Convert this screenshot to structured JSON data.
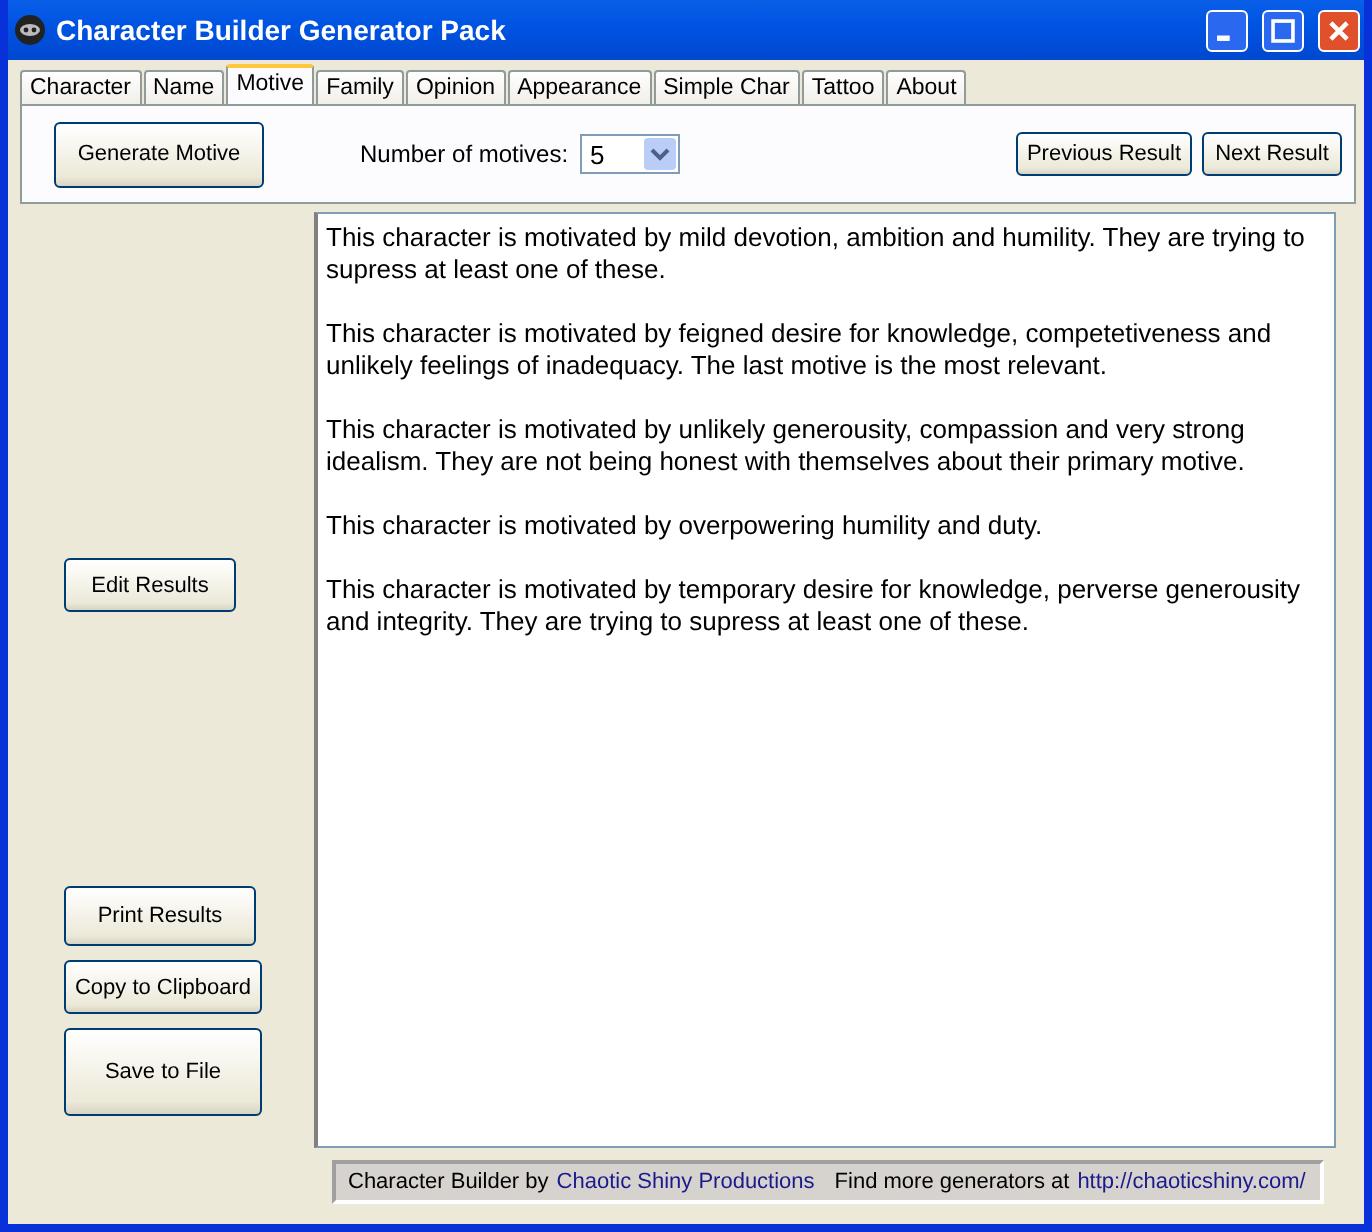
{
  "window": {
    "title": "Character Builder Generator Pack"
  },
  "tabs": [
    {
      "label": "Character",
      "selected": false
    },
    {
      "label": "Name",
      "selected": false
    },
    {
      "label": "Motive",
      "selected": true
    },
    {
      "label": "Family",
      "selected": false
    },
    {
      "label": "Opinion",
      "selected": false
    },
    {
      "label": "Appearance",
      "selected": false
    },
    {
      "label": "Simple Char",
      "selected": false
    },
    {
      "label": "Tattoo",
      "selected": false
    },
    {
      "label": "About",
      "selected": false
    }
  ],
  "toolbar": {
    "generate_button": "Generate Motive",
    "motives_label": "Number of motives:",
    "motives_value": "5",
    "previous_button": "Previous Result",
    "next_button": "Next Result"
  },
  "side_buttons": {
    "edit": "Edit Results",
    "print": "Print Results",
    "copy": "Copy to Clipboard",
    "save": "Save to File"
  },
  "results": [
    "This character is motivated by mild devotion, ambition and humility. They are trying to supress at least one of these.",
    "This character is motivated by feigned desire for knowledge, competetiveness and unlikely feelings of inadequacy. The last motive is the most relevant.",
    "This character is motivated by unlikely generousity, compassion and very strong idealism. They are not being honest with themselves about their primary motive.",
    "This character is motivated by overpowering humility and duty.",
    "This character is motivated by temporary desire for knowledge, perverse generousity and integrity. They are trying to supress at least one of these."
  ],
  "status_bar": {
    "credit_prefix": "Character Builder by",
    "credit_link": "Chaotic Shiny Productions",
    "more_prefix": "Find more generators at",
    "more_link": "http://chaoticshiny.com/"
  }
}
